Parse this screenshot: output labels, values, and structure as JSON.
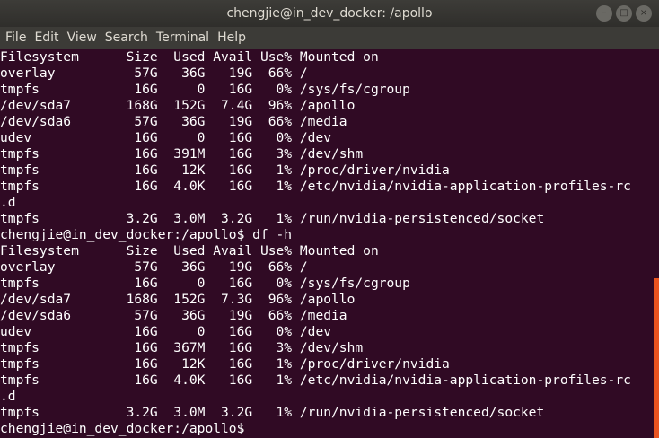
{
  "window": {
    "title": "chengjie@in_dev_docker: /apollo",
    "controls": {
      "minimize_glyph": "–",
      "maximize_glyph": "□",
      "close_glyph": "×",
      "minimize_icon": "minimize-icon",
      "maximize_icon": "maximize-icon",
      "close_icon": "close-icon"
    }
  },
  "menu": {
    "items": [
      "File",
      "Edit",
      "View",
      "Search",
      "Terminal",
      "Help"
    ]
  },
  "colors": {
    "terminal_bg": "#300a24",
    "text": "#ffffff",
    "titlebar_bg": "#3d3c38",
    "menubar_bg": "#3c3b37",
    "scrollbar_thumb": "#e95420"
  },
  "scrollbar": {
    "position_fraction": 0.59,
    "visible_fraction": 0.41
  },
  "terminal": {
    "lines": [
      "Filesystem      Size  Used Avail Use% Mounted on",
      "overlay          57G   36G   19G  66% /",
      "tmpfs            16G     0   16G   0% /sys/fs/cgroup",
      "/dev/sda7       168G  152G  7.4G  96% /apollo",
      "/dev/sda6        57G   36G   19G  66% /media",
      "udev             16G     0   16G   0% /dev",
      "tmpfs            16G  391M   16G   3% /dev/shm",
      "tmpfs            16G   12K   16G   1% /proc/driver/nvidia",
      "tmpfs            16G  4.0K   16G   1% /etc/nvidia/nvidia-application-profiles-rc",
      ".d",
      "tmpfs           3.2G  3.0M  3.2G   1% /run/nvidia-persistenced/socket",
      "chengjie@in_dev_docker:/apollo$ df -h",
      "Filesystem      Size  Used Avail Use% Mounted on",
      "overlay          57G   36G   19G  66% /",
      "tmpfs            16G     0   16G   0% /sys/fs/cgroup",
      "/dev/sda7       168G  152G  7.3G  96% /apollo",
      "/dev/sda6        57G   36G   19G  66% /media",
      "udev             16G     0   16G   0% /dev",
      "tmpfs            16G  367M   16G   3% /dev/shm",
      "tmpfs            16G   12K   16G   1% /proc/driver/nvidia",
      "tmpfs            16G  4.0K   16G   1% /etc/nvidia/nvidia-application-profiles-rc",
      ".d",
      "tmpfs           3.2G  3.0M  3.2G   1% /run/nvidia-persistenced/socket",
      "chengjie@in_dev_docker:/apollo$ "
    ]
  }
}
